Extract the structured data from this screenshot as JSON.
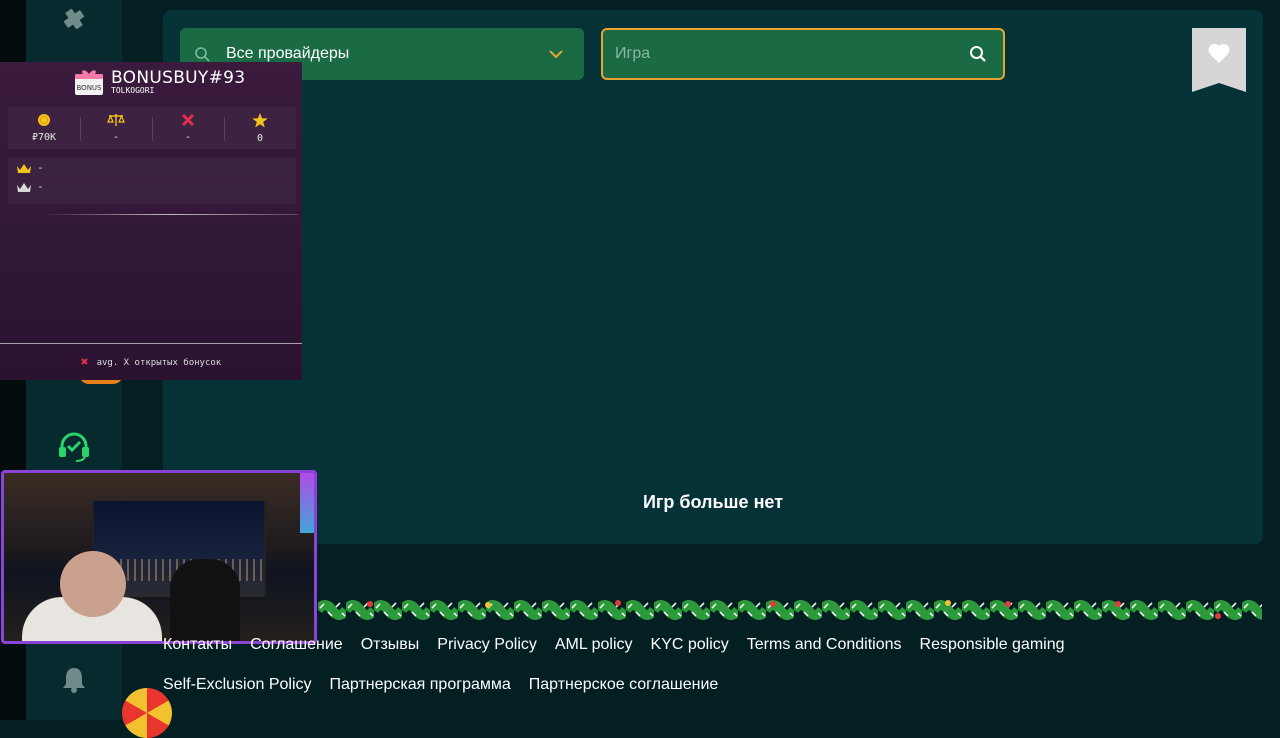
{
  "providers_select": {
    "label": "Все провайдеры"
  },
  "game_search": {
    "placeholder": "Игра"
  },
  "empty_message": "Игр больше нет",
  "bonus_overlay": {
    "title": "BONUSBUY#93",
    "subtitle": "TOLKOGORI",
    "logo_text": "BONUS",
    "stats": [
      {
        "icon": "coin-icon",
        "value": "₽70K"
      },
      {
        "icon": "scales-icon",
        "value": "-"
      },
      {
        "icon": "cross-icon",
        "value": "-"
      },
      {
        "icon": "star-icon",
        "value": "0"
      }
    ],
    "ranks": [
      {
        "icon": "crown-gold-icon",
        "value": "-"
      },
      {
        "icon": "crown-silver-icon",
        "value": "-"
      }
    ],
    "footer": "avg. X открытых бонусок"
  },
  "footer_links": {
    "row1": [
      "Контакты",
      "Соглашение",
      "Отзывы",
      "Privacy Policy",
      "AML policy",
      "KYC policy",
      "Terms and Conditions",
      "Responsible gaming"
    ],
    "row2": [
      "Self-Exclusion Policy",
      "Партнерская программа",
      "Партнерское соглашение"
    ]
  },
  "colors": {
    "page_bg": "#041f22",
    "panel_bg": "#053237",
    "input_bg": "#1a6b44",
    "accent_border": "#e8a431",
    "support_icon": "#2bd46b"
  }
}
